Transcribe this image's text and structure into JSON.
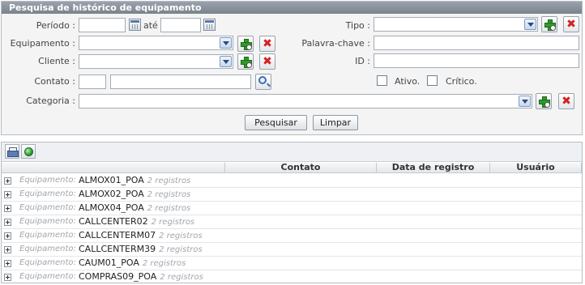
{
  "panel": {
    "title": "Pesquisa de histórico de equipamento",
    "labels": {
      "periodo": "Período :",
      "ate": "até",
      "equipamento": "Equipamento :",
      "cliente": "Cliente :",
      "contato": "Contato :",
      "categoria": "Categoria :",
      "tipo": "Tipo :",
      "palavra_chave": "Palavra-chave :",
      "id": "ID :",
      "ativo": "Ativo.",
      "critico": "Crítico."
    },
    "values": {
      "periodo_inicio": "",
      "periodo_fim": "",
      "equipamento": "",
      "cliente": "",
      "contato_codigo": "",
      "contato_nome": "",
      "categoria": "",
      "tipo": "",
      "palavra_chave": "",
      "id": "",
      "ativo": false,
      "critico": false
    },
    "buttons": {
      "pesquisar": "Pesquisar",
      "limpar": "Limpar"
    }
  },
  "grid": {
    "columns": [
      "Contato",
      "Data de registro",
      "Usuário"
    ],
    "group_label": "Equipamento:",
    "groups": [
      {
        "name": "ALMOX01_POA",
        "count": "2 registros"
      },
      {
        "name": "ALMOX02_POA",
        "count": "2 registros"
      },
      {
        "name": "ALMOX04_POA",
        "count": "2 registros"
      },
      {
        "name": "CALLCENTER02",
        "count": "2 registros"
      },
      {
        "name": "CALLCENTERM07",
        "count": "2 registros"
      },
      {
        "name": "CALLCENTERM39",
        "count": "2 registros"
      },
      {
        "name": "CAUM01_POA",
        "count": "2 registros"
      },
      {
        "name": "COMPRAS09_POA",
        "count": "2 registros"
      }
    ]
  },
  "icons": {
    "calendar": "calendar-icon",
    "add": "add-icon",
    "remove": "remove-icon",
    "search": "search-icon",
    "print": "printer-icon",
    "refresh": "globe-icon",
    "expand": "expand-icon"
  },
  "colors": {
    "header_bg": "#8a939d",
    "add_green": "#2f9a2a",
    "remove_red": "#d52020"
  }
}
